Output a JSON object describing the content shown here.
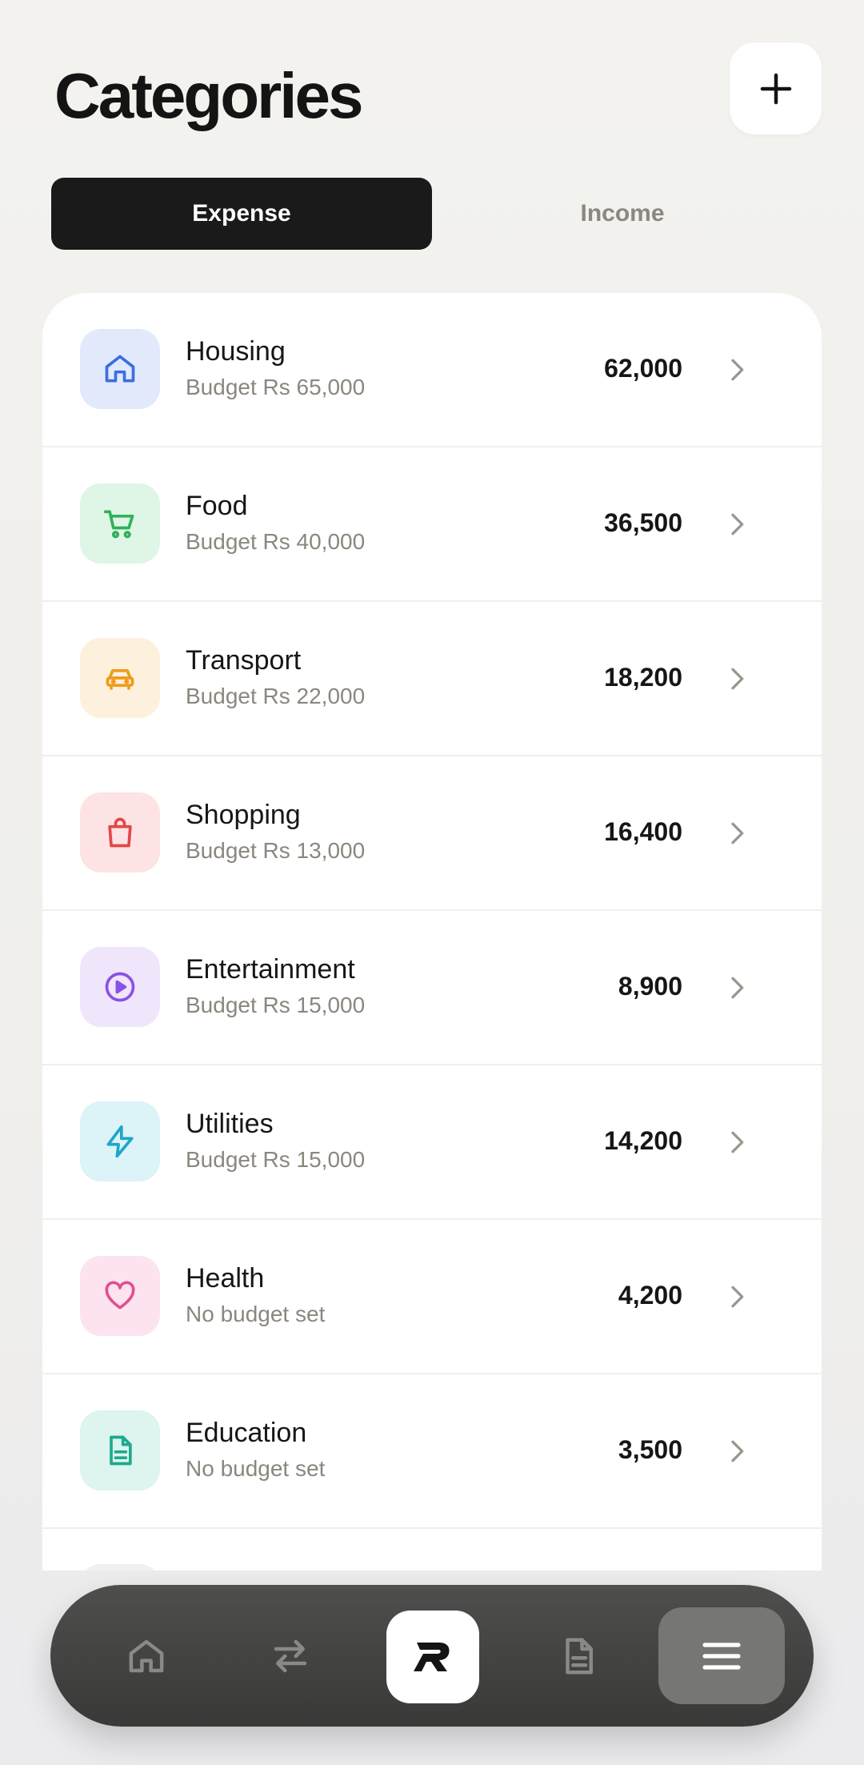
{
  "header": {
    "title": "Categories",
    "add_icon": "plus-icon"
  },
  "tabs": [
    {
      "label": "Expense",
      "active": true
    },
    {
      "label": "Income",
      "active": false
    }
  ],
  "categories": [
    {
      "name": "Housing",
      "sub": "Budget Rs 65,000",
      "amount": "62,000",
      "icon": "home-icon",
      "tile": "#e2e9fb",
      "color": "#3b6ee0"
    },
    {
      "name": "Food",
      "sub": "Budget Rs 40,000",
      "amount": "36,500",
      "icon": "cart-icon",
      "tile": "#dff5e6",
      "color": "#2fb25a"
    },
    {
      "name": "Transport",
      "sub": "Budget Rs 22,000",
      "amount": "18,200",
      "icon": "car-icon",
      "tile": "#fdf0dc",
      "color": "#f09a1a"
    },
    {
      "name": "Shopping",
      "sub": "Budget Rs 13,000",
      "amount": "16,400",
      "icon": "shopping-bag-icon",
      "tile": "#fde3e3",
      "color": "#e04848"
    },
    {
      "name": "Entertainment",
      "sub": "Budget Rs 15,000",
      "amount": "8,900",
      "icon": "play-icon",
      "tile": "#efe6fb",
      "color": "#8a52e6"
    },
    {
      "name": "Utilities",
      "sub": "Budget Rs 15,000",
      "amount": "14,200",
      "icon": "bolt-icon",
      "tile": "#dcf3f8",
      "color": "#1ea6c8"
    },
    {
      "name": "Health",
      "sub": "No budget set",
      "amount": "4,200",
      "icon": "heart-icon",
      "tile": "#fce3ef",
      "color": "#e0508f"
    },
    {
      "name": "Education",
      "sub": "No budget set",
      "amount": "3,500",
      "icon": "document-icon",
      "tile": "#ddf4ef",
      "color": "#1daa8c"
    }
  ],
  "nav": {
    "items": [
      "home-icon",
      "transfer-icon",
      "logo-icon",
      "document-icon",
      "menu-icon"
    ],
    "active": "menu-icon"
  }
}
